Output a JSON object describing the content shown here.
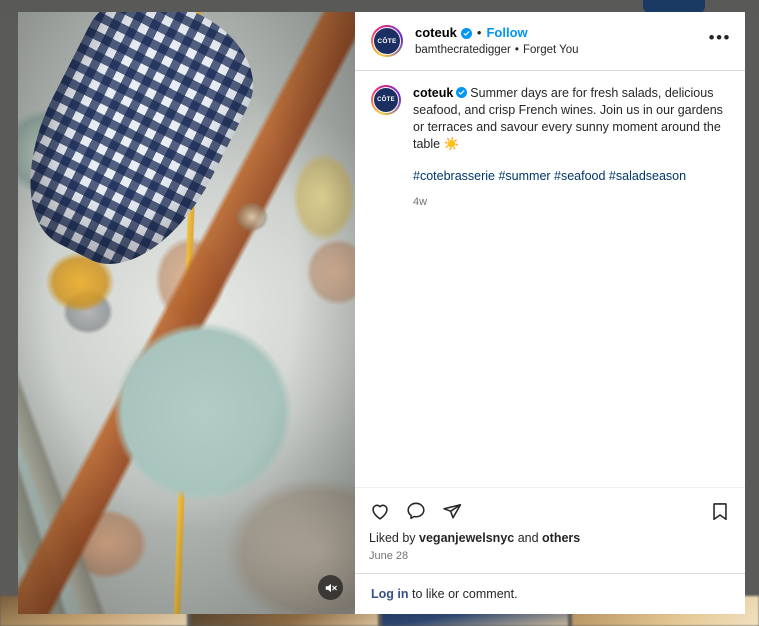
{
  "backdrop": {
    "top_button_label": ""
  },
  "media": {
    "alt": "overhead-shot-of-salmon-dish-fries-and-white-wine-on-marble-table",
    "mute_icon": "muted-speaker-icon",
    "is_video": true
  },
  "header": {
    "avatar": {
      "icon": "cote-avatar",
      "monogram": "CÔTE"
    },
    "username": "coteuk",
    "verified_icon": "verified-badge-icon",
    "separator": "•",
    "follow_label": "Follow",
    "audio_author": "bamthecratedigger",
    "audio_separator": "•",
    "audio_title": "Forget You",
    "more_options_icon": "ellipsis-icon",
    "more_options_label": "•••"
  },
  "caption": {
    "avatar": {
      "icon": "cote-avatar",
      "monogram": "CÔTE"
    },
    "username": "coteuk",
    "verified_icon": "verified-badge-icon",
    "text": "Summer days are for fresh salads, delicious seafood, and crisp French wines. Join us in our gardens or terraces and savour every sunny moment around the table ☀️",
    "hashtags": "#cotebrasserie #summer #seafood #saladseason",
    "timestamp": "4w"
  },
  "actions": {
    "like_icon": "heart-icon",
    "comment_icon": "comment-bubble-icon",
    "share_icon": "share-paper-plane-icon",
    "save_icon": "bookmark-icon",
    "liked_by_prefix": "Liked by ",
    "liked_by_user": "veganjewelsnyc",
    "liked_by_suffix": " and ",
    "liked_by_others": "others",
    "post_date": "June 28"
  },
  "login": {
    "link_label": "Log in",
    "rest_label": " to like or comment."
  },
  "colors": {
    "instagram_blue": "#0095f6",
    "link_navy": "#00376b",
    "login_navy": "#385185",
    "verified_blue": "#0095f6",
    "border": "#dbdbdb",
    "text_primary": "#262626",
    "text_muted": "#737373",
    "brand_navy": "#1b2f63"
  }
}
